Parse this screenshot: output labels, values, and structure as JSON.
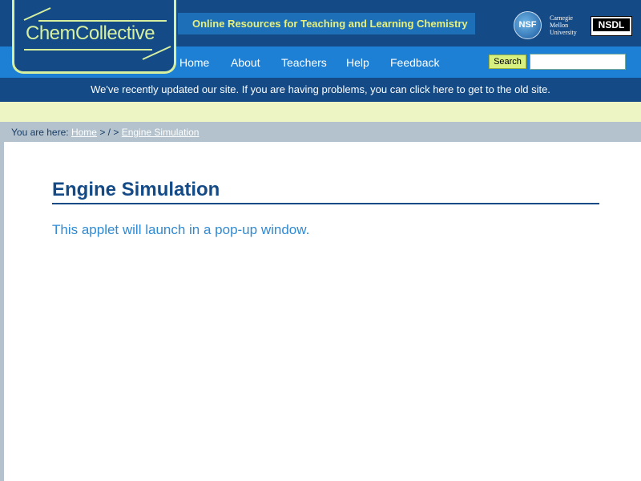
{
  "logo": {
    "text": "ChemCollective"
  },
  "header": {
    "tagline": "Online Resources for Teaching and Learning Chemistry"
  },
  "partners": {
    "nsf": "NSF",
    "cmu": [
      "Carnegie",
      "Mellon",
      "University"
    ],
    "nsdl": "NSDL"
  },
  "nav": [
    "Home",
    "About",
    "Teachers",
    "Help",
    "Feedback"
  ],
  "search": {
    "button_label": "Search",
    "value": ""
  },
  "notice": "We've recently updated our site. If you are having problems, you can click here to get to the old site.",
  "breadcrumb": {
    "prefix": "You are here:",
    "home": "Home",
    "sep": "> / >",
    "current": "Engine Simulation"
  },
  "page": {
    "title": "Engine Simulation",
    "description": "This applet will launch in a pop-up window."
  },
  "colors": {
    "navy": "#144a86",
    "blue": "#1e80d4",
    "lime": "#d6f0a0",
    "tagline_text": "#e8f07a"
  }
}
